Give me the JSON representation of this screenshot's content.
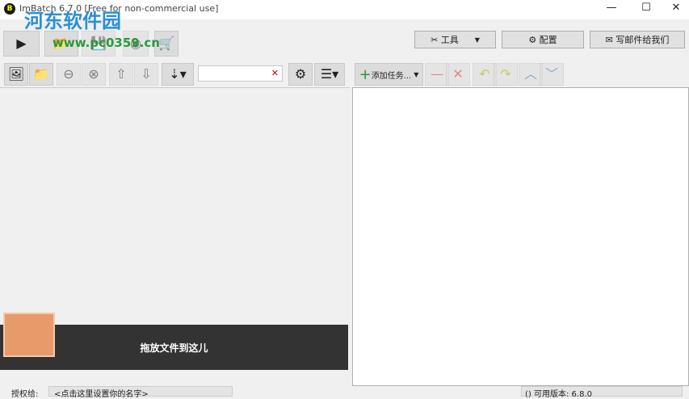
{
  "window": {
    "title": "ImBatch 6.7.0 [Free for non-commercial use]",
    "minimize": "—",
    "maximize": "☐",
    "close": "✕"
  },
  "watermark": {
    "name": "河东软件园",
    "url": "www.pc0359.cn"
  },
  "top_buttons": {
    "tools": "工具",
    "settings": "配置",
    "email": "写邮件给我们"
  },
  "task_toolbar": {
    "add_task": "添加任务..."
  },
  "drop_zone": {
    "text": "拖放文件到这儿"
  },
  "status": {
    "license_label": "授权给:",
    "license_value": "<点击这里设置你的名字>",
    "version_label": "可用版本:",
    "version_value": "6.8.0"
  }
}
